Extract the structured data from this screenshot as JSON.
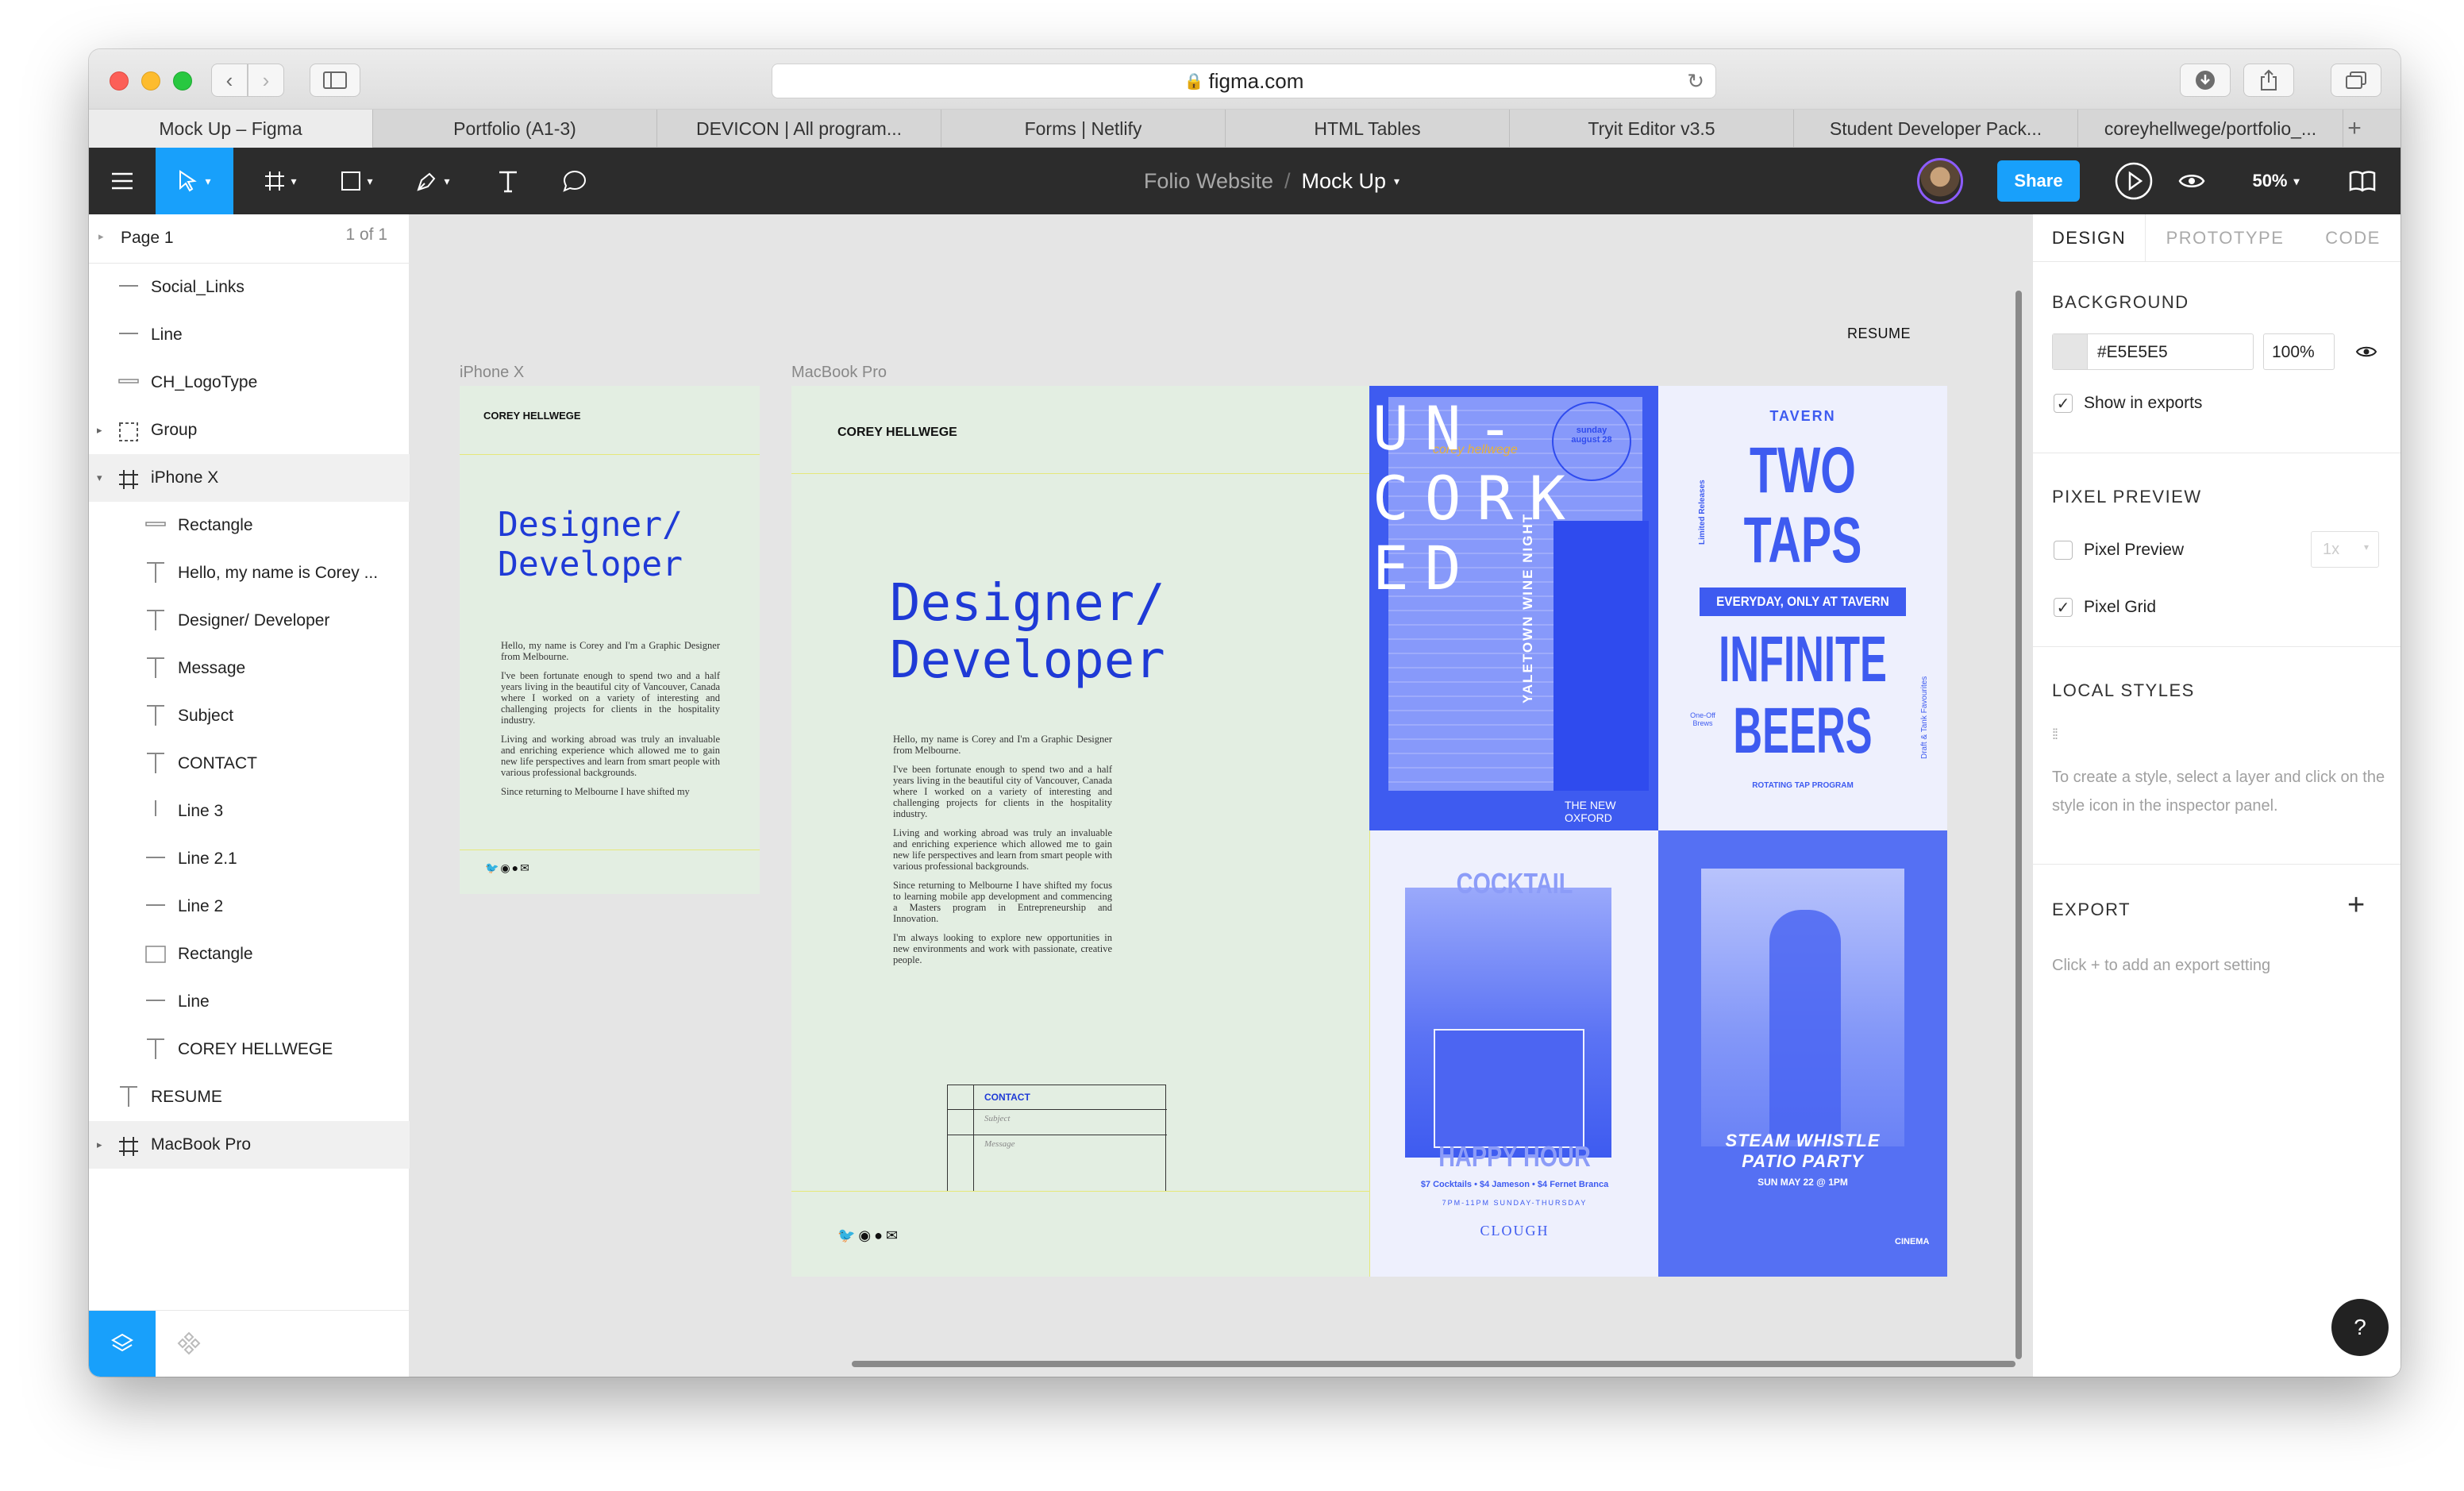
{
  "browser": {
    "url": "figma.com",
    "tabs": [
      "Mock Up – Figma",
      "Portfolio (A1-3)",
      "DEVICON | All program...",
      "Forms | Netlify",
      "HTML Tables",
      "Tryit Editor v3.5",
      "Student Developer Pack...",
      "coreyhellwege/portfolio_..."
    ]
  },
  "toolbar": {
    "project": "Folio Website",
    "separator": "/",
    "file": "Mock Up",
    "share_label": "Share",
    "zoom": "50%"
  },
  "pages": {
    "label": "Page 1",
    "count": "1 of 1"
  },
  "layers": [
    {
      "label": "Social_Links"
    },
    {
      "label": "Line"
    },
    {
      "label": "CH_LogoType"
    },
    {
      "label": "Group"
    },
    {
      "label": "iPhone X"
    },
    {
      "label": "Rectangle"
    },
    {
      "label": "Hello, my name is Corey ..."
    },
    {
      "label": "Designer/ Developer"
    },
    {
      "label": "Message"
    },
    {
      "label": "Subject"
    },
    {
      "label": "CONTACT"
    },
    {
      "label": "Line 3"
    },
    {
      "label": "Line 2.1"
    },
    {
      "label": "Line 2"
    },
    {
      "label": "Rectangle"
    },
    {
      "label": "Line"
    },
    {
      "label": "COREY HELLWEGE"
    },
    {
      "label": "RESUME"
    },
    {
      "label": "MacBook Pro"
    }
  ],
  "canvas": {
    "resume": "RESUME",
    "iphone_label": "iPhone X",
    "macbook_label": "MacBook Pro",
    "brand": "COREY HELLWEGE",
    "heading_1": "Designer/",
    "heading_2": "Developer",
    "intro_1": "Hello, my name is Corey and I'm a Graphic Designer from Melbourne.",
    "intro_2": "I've been fortunate enough to spend two and a half years living in the beautiful city of Vancouver, Canada where I worked on a variety of interesting and challenging projects for clients in the hospitality industry.",
    "intro_3": "Living and working abroad was truly an invaluable and enriching experience which allowed me to gain new life perspectives and learn from smart people with various professional backgrounds.",
    "intro_4": "Since returning to Melbourne I have shifted my focus to learning mobile app development and commencing a Masters program in Entrepreneurship and Innovation.",
    "intro_5": "I'm always looking to explore new opportunities in new environments and work with passionate, creative people.",
    "intro_cut": "Since returning to Melbourne I have shifted my",
    "contact": "CONTACT",
    "subject": "Subject",
    "message": "Message",
    "poster1": {
      "big": "UN- CORK ED",
      "side": "YALETOWN WINE NIGHT",
      "footer": "THE NEW OXFORD",
      "badge": "sunday august 28",
      "script": "corey hellwege"
    },
    "poster2": {
      "top": "TAVERN",
      "l1": "TWO",
      "l2": "TAPS",
      "band": "EVERYDAY, ONLY AT TAVERN",
      "l3": "INFINITE",
      "l4": "BEERS",
      "sub": "ROTATING TAP PROGRAM",
      "side_l": "Limited Releases",
      "side_r": "Draft & Tank Favourites",
      "mid_l": "One-Off Brews"
    },
    "poster3": {
      "top": "COCKTAIL",
      "bottom": "HAPPY HOUR",
      "deal": "$7 Cocktails • $4 Jameson • $4 Fernet Branca",
      "hours": "7PM-11PM SUNDAY-THURSDAY",
      "brand": "CLOUGH"
    },
    "poster4": {
      "l1": "STEAM WHISTLE",
      "l2": "PATIO PARTY",
      "date": "SUN MAY 22 @ 1PM",
      "brand": "CINEMA"
    }
  },
  "inspector": {
    "tabs": [
      "DESIGN",
      "PROTOTYPE",
      "CODE"
    ],
    "background_title": "BACKGROUND",
    "bg_hex": "#E5E5E5",
    "bg_opacity": "100%",
    "show_exports": "Show in exports",
    "pixel_preview_title": "PIXEL PREVIEW",
    "pixel_preview": "Pixel Preview",
    "pixel_preview_scale": "1x",
    "pixel_grid": "Pixel Grid",
    "local_styles_title": "LOCAL STYLES",
    "local_styles_hint": "To create a style, select a layer and click on the style icon in the inspector panel.",
    "export_title": "EXPORT",
    "export_hint": "Click + to add an export setting",
    "help": "?"
  },
  "colors": {
    "accent": "#18a0fb",
    "poster_blue": "#3e5bf0",
    "mock_green": "#e3eee2",
    "heading_blue": "#1f3ad6"
  }
}
